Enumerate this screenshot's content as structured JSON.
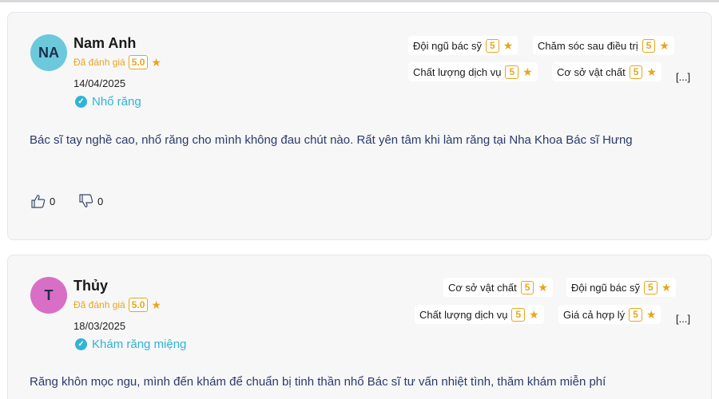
{
  "colors": {
    "accent": "#e8a51d",
    "service": "#2fb4d6",
    "text": "#2a3b6a"
  },
  "reviews": [
    {
      "initials": "NA",
      "avatar_color": "#6cc9dc",
      "name": "Nam Anh",
      "rated_label": "Đã đánh giá",
      "score": "5.0",
      "date": "14/04/2025",
      "service": "Nhổ răng",
      "tags": [
        {
          "label": "Đội ngũ bác sỹ",
          "score": "5"
        },
        {
          "label": "Chăm sóc sau điều trị",
          "score": "5"
        },
        {
          "label": "Chất lượng dịch vụ",
          "score": "5"
        },
        {
          "label": "Cơ sở vật chất",
          "score": "5"
        }
      ],
      "more": "[...]",
      "content": "Bác sĩ tay nghề cao, nhổ răng cho mình không đau chút nào. Rất yên tâm khi làm răng tại Nha Khoa Bác sĩ Hưng",
      "likes": "0",
      "dislikes": "0"
    },
    {
      "initials": "T",
      "avatar_color": "#d96ec6",
      "name": "Thủy",
      "rated_label": "Đã đánh giá",
      "score": "5.0",
      "date": "18/03/2025",
      "service": "Khám răng miệng",
      "tags": [
        {
          "label": "Cơ sở vật chất",
          "score": "5"
        },
        {
          "label": "Đội ngũ bác sỹ",
          "score": "5"
        },
        {
          "label": "Chất lượng dịch vụ",
          "score": "5"
        },
        {
          "label": "Giá cả hợp lý",
          "score": "5"
        }
      ],
      "more": "[...]",
      "content": "Răng khôn mọc ngu, mình đến khám để chuẩn bị tinh thần nhổ Bác sĩ tư vấn nhiệt tình, thăm khám miễn phí"
    }
  ]
}
